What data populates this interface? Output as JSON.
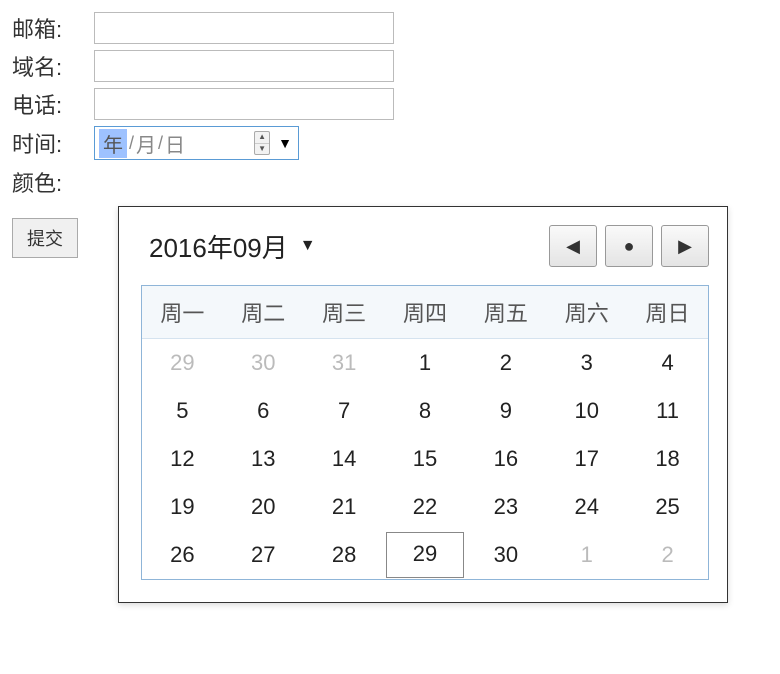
{
  "form": {
    "email": {
      "label": "邮箱:",
      "value": ""
    },
    "domain": {
      "label": "域名:",
      "value": ""
    },
    "phone": {
      "label": "电话:",
      "value": ""
    },
    "time": {
      "label": "时间:",
      "year_ph": "年",
      "month_ph": "月",
      "day_ph": "日",
      "sep": "/"
    },
    "color": {
      "label": "颜色:"
    },
    "submit": "提交"
  },
  "datepicker": {
    "title": "2016年09月",
    "nav": {
      "prev": "◀",
      "today": "●",
      "next": "▶"
    },
    "weekdays": [
      "周一",
      "周二",
      "周三",
      "周四",
      "周五",
      "周六",
      "周日"
    ],
    "days": [
      {
        "n": "29",
        "muted": true
      },
      {
        "n": "30",
        "muted": true
      },
      {
        "n": "31",
        "muted": true
      },
      {
        "n": "1"
      },
      {
        "n": "2"
      },
      {
        "n": "3"
      },
      {
        "n": "4"
      },
      {
        "n": "5"
      },
      {
        "n": "6"
      },
      {
        "n": "7"
      },
      {
        "n": "8"
      },
      {
        "n": "9"
      },
      {
        "n": "10"
      },
      {
        "n": "11"
      },
      {
        "n": "12"
      },
      {
        "n": "13"
      },
      {
        "n": "14"
      },
      {
        "n": "15"
      },
      {
        "n": "16"
      },
      {
        "n": "17"
      },
      {
        "n": "18"
      },
      {
        "n": "19"
      },
      {
        "n": "20"
      },
      {
        "n": "21"
      },
      {
        "n": "22"
      },
      {
        "n": "23"
      },
      {
        "n": "24"
      },
      {
        "n": "25"
      },
      {
        "n": "26"
      },
      {
        "n": "27"
      },
      {
        "n": "28"
      },
      {
        "n": "29",
        "today": true
      },
      {
        "n": "30"
      },
      {
        "n": "1",
        "muted": true
      },
      {
        "n": "2",
        "muted": true
      }
    ]
  }
}
